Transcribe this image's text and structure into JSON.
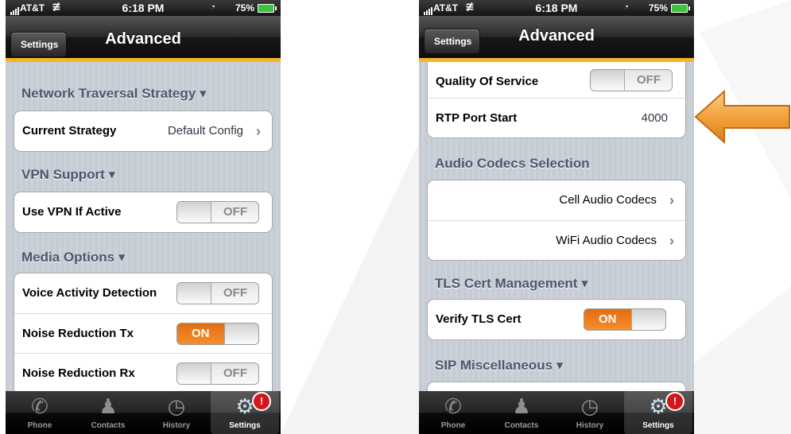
{
  "colors": {
    "accent_orange": "#f68d2a",
    "nav_stripe": "#f3b62b",
    "section_text": "#4c566c",
    "badge_red": "#d4161c",
    "arrow_orange": "#f2a13e"
  },
  "status_bar": {
    "carrier": "AT&T",
    "time": "6:18 PM",
    "battery": "75%"
  },
  "nav": {
    "back_label": "Settings",
    "title": "Advanced"
  },
  "tabs": [
    {
      "label": "Phone",
      "icon": "phone-icon"
    },
    {
      "label": "Contacts",
      "icon": "contacts-icon"
    },
    {
      "label": "History",
      "icon": "clock-icon"
    },
    {
      "label": "Settings",
      "icon": "gears-icon",
      "active": true,
      "badge": "!"
    }
  ],
  "left_screen": {
    "sections": [
      {
        "header": "Network Traversal Strategy ▾",
        "rows": [
          {
            "label": "Current Strategy",
            "value": "Default Config"
          }
        ]
      },
      {
        "header": "VPN Support ▾",
        "rows": [
          {
            "label": "Use VPN If Active",
            "toggle": "OFF"
          }
        ]
      },
      {
        "header": "Media Options ▾",
        "rows": [
          {
            "label": "Voice Activity Detection",
            "toggle": "OFF"
          },
          {
            "label": "Noise Reduction Tx",
            "toggle": "ON"
          },
          {
            "label": "Noise Reduction Rx",
            "toggle": "OFF"
          }
        ]
      }
    ]
  },
  "right_screen": {
    "rows_top": [
      {
        "label": "Quality Of Service",
        "toggle": "OFF"
      },
      {
        "label": "RTP Port Start",
        "value": "4000"
      }
    ],
    "sections": [
      {
        "header": "Audio Codecs Selection",
        "rows": [
          {
            "label": "Cell Audio Codecs"
          },
          {
            "label": "WiFi Audio Codecs"
          }
        ]
      },
      {
        "header": "TLS Cert Management ▾",
        "rows": [
          {
            "label": "Verify TLS Cert",
            "toggle": "ON"
          }
        ]
      },
      {
        "header": "SIP Miscellaneous ▾"
      }
    ]
  }
}
